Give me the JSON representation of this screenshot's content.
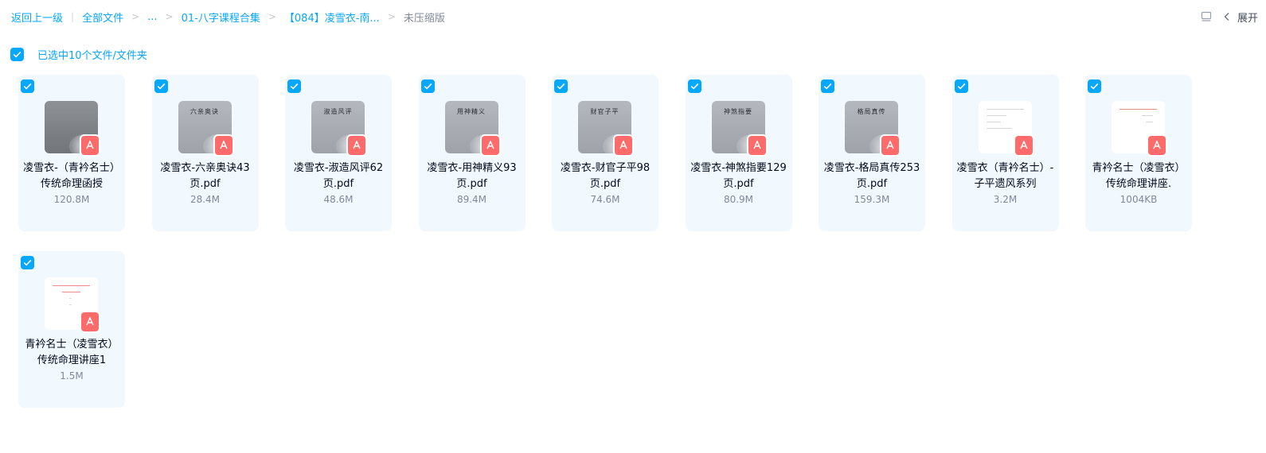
{
  "breadcrumb": {
    "back": "返回上一级",
    "all_files": "全部文件",
    "ellipsis": "...",
    "folder1": "01-八字课程合集",
    "folder2": "【084】凌雪衣-南...",
    "current": "未压缩版"
  },
  "toolbar": {
    "expand_label": "展开"
  },
  "selection": {
    "text": "已选中10个文件/文件夹"
  },
  "files": [
    {
      "name": "凌雪衣-（青衿名士）传统命理函授",
      "size": "120.8M",
      "thumb": "scan-dark",
      "thumb_title": ""
    },
    {
      "name": "凌雪衣-六亲奥诀43页.pdf",
      "size": "28.4M",
      "thumb": "scan",
      "thumb_title": "六亲奥诀"
    },
    {
      "name": "凌雪衣-淑造风评62页.pdf",
      "size": "48.6M",
      "thumb": "scan",
      "thumb_title": "淑造风评"
    },
    {
      "name": "凌雪衣-用神精义93页.pdf",
      "size": "89.4M",
      "thumb": "scan",
      "thumb_title": "用神精义"
    },
    {
      "name": "凌雪衣-财官子平98页.pdf",
      "size": "74.6M",
      "thumb": "scan",
      "thumb_title": "财官子平"
    },
    {
      "name": "凌雪衣-神煞指要129页.pdf",
      "size": "80.9M",
      "thumb": "scan",
      "thumb_title": "神煞指要"
    },
    {
      "name": "凌雪衣-格局真传253页.pdf",
      "size": "159.3M",
      "thumb": "scan",
      "thumb_title": "格局真传"
    },
    {
      "name": "凌雪衣（青衿名士）-子平遗风系列",
      "size": "3.2M",
      "thumb": "white",
      "thumb_title": ""
    },
    {
      "name": "青衿名士（凌雪衣）传统命理讲座.",
      "size": "1004KB",
      "thumb": "white-red",
      "thumb_title": ""
    },
    {
      "name": "青衿名士（凌雪衣）传统命理讲座1",
      "size": "1.5M",
      "thumb": "white-red",
      "thumb_title": ""
    }
  ],
  "colors": {
    "accent": "#06a7ff",
    "card_bg": "#f1f8fe",
    "pdf_badge": "#ff6b6b",
    "text_secondary": "#818999"
  }
}
